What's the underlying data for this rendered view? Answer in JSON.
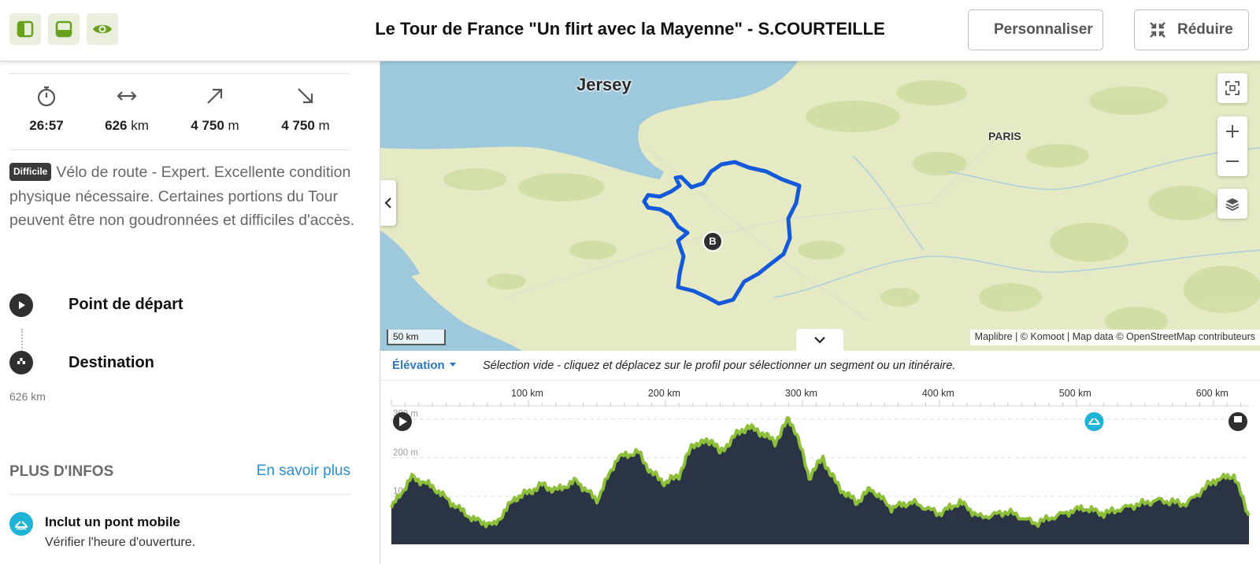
{
  "header": {
    "title": "Le Tour de France \"Un flirt avec la Mayenne\" - S.COURTEILLE",
    "customize_label": "Personnaliser",
    "reduce_label": "Réduire",
    "accent_color": "#6aa11c"
  },
  "stats": {
    "duration": "26:57",
    "distance_value": "626",
    "distance_unit": "km",
    "uphill_value": "4 750",
    "uphill_unit": "m",
    "downhill_value": "4 750",
    "downhill_unit": "m"
  },
  "difficulty": {
    "badge": "Difficile",
    "text": "Vélo de route - Expert. Excellente condition physique nécessaire. Certaines portions du Tour peuvent être non goudronnées et difficiles d'accès."
  },
  "waypoints": {
    "start_label": "Point de départ",
    "destination_label": "Destination",
    "destination_distance": "626 km"
  },
  "more_info": {
    "title": "PLUS D'INFOS",
    "link": "En savoir plus",
    "bridge_title": "Inclut un pont mobile",
    "bridge_subtitle": "Vérifier l'heure d'ouverture."
  },
  "map": {
    "label_jersey": "Jersey",
    "label_paris": "PARIS",
    "marker_label": "B",
    "scale": "50 km",
    "attribution": "Maplibre | © Komoot | Map data © OpenStreetMap contributeurs",
    "route_color": "#1459d9"
  },
  "elevation": {
    "dropdown": "Élévation",
    "hint": "Sélection vide - cliquez et déplacez sur le profil pour sélectionner un segment ou un itinéraire.",
    "x_ticks": [
      "100 km",
      "200 km",
      "300 km",
      "400 km",
      "500 km",
      "600 km"
    ],
    "y_ticks": [
      "300 m",
      "200 m",
      "100 m"
    ],
    "bridge_marker_km": 513,
    "total_km": 626
  },
  "chart_data": {
    "type": "area",
    "xlabel": "",
    "ylabel": "",
    "xlim": [
      0,
      626
    ],
    "ylim": [
      0,
      330
    ],
    "x_unit": "km",
    "y_unit": "m",
    "x": [
      0,
      15,
      30,
      45,
      60,
      75,
      90,
      100,
      110,
      120,
      135,
      150,
      165,
      180,
      190,
      200,
      210,
      220,
      230,
      235,
      240,
      250,
      260,
      270,
      280,
      290,
      295,
      305,
      315,
      320,
      330,
      340,
      350,
      365,
      380,
      400,
      415,
      430,
      450,
      470,
      490,
      505,
      520,
      540,
      560,
      580,
      600,
      615,
      626
    ],
    "y": [
      70,
      150,
      125,
      80,
      40,
      25,
      95,
      110,
      130,
      115,
      140,
      90,
      200,
      215,
      160,
      135,
      155,
      235,
      240,
      245,
      210,
      255,
      280,
      265,
      240,
      300,
      270,
      150,
      200,
      160,
      110,
      85,
      120,
      70,
      85,
      55,
      85,
      45,
      60,
      30,
      55,
      70,
      55,
      75,
      90,
      80,
      140,
      155,
      50
    ]
  }
}
